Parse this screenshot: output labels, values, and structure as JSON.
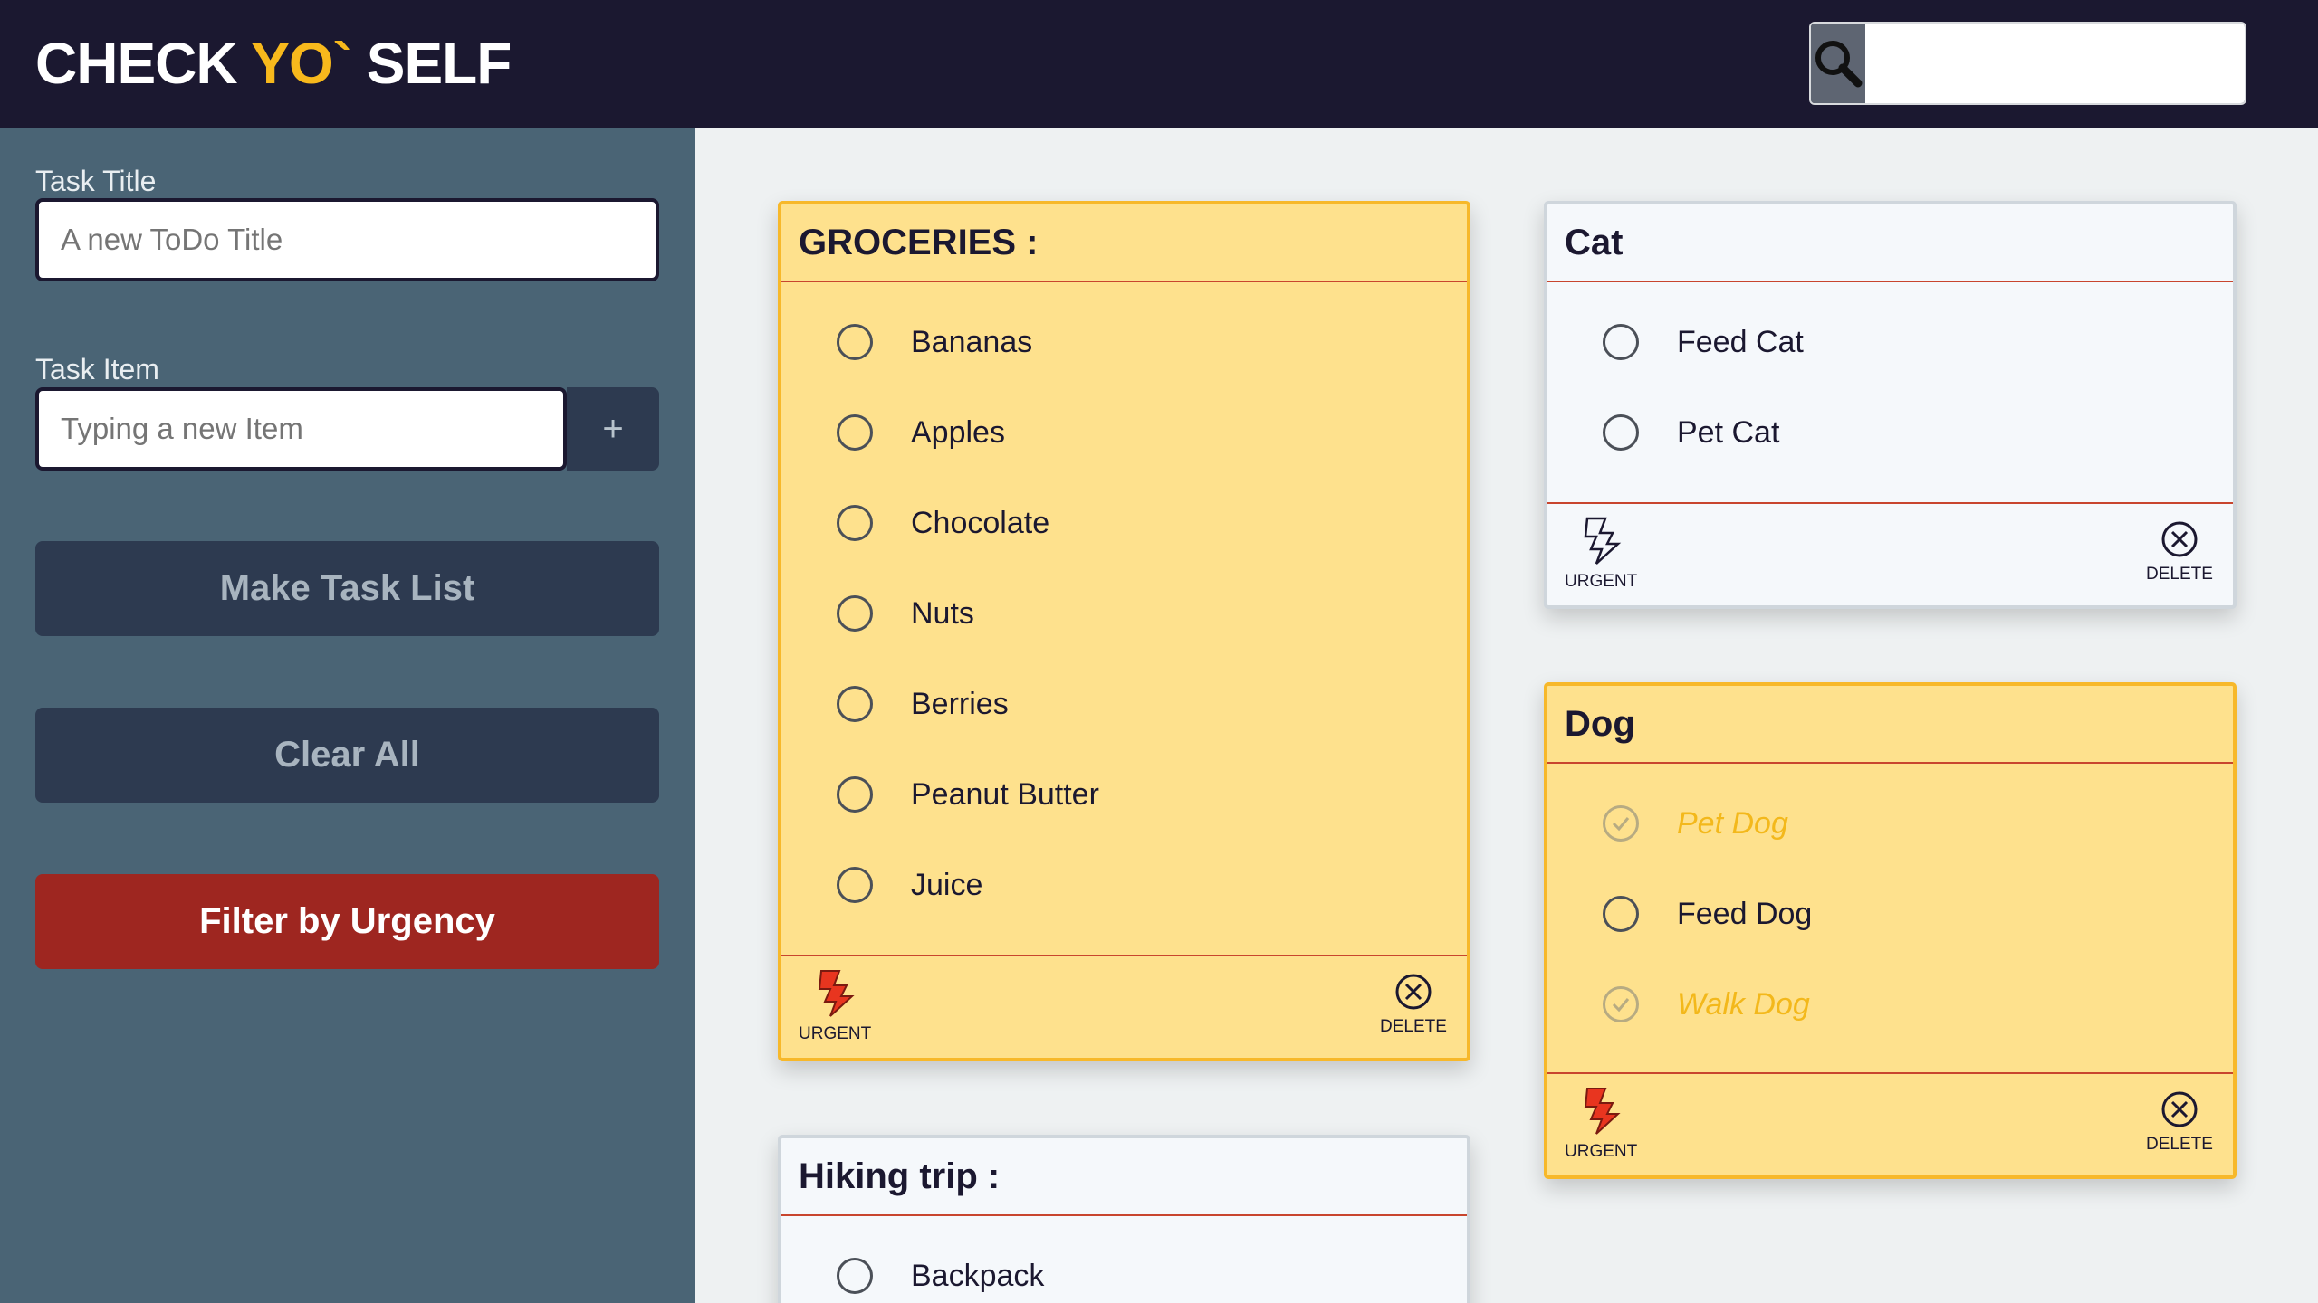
{
  "header": {
    "logo_part1": "CHECK ",
    "logo_accent": "YO`",
    "logo_part2": " SELF",
    "search_value": ""
  },
  "sidebar": {
    "task_title_label": "Task Title",
    "task_title_placeholder": "A new ToDo Title",
    "task_item_label": "Task Item",
    "task_item_placeholder": "Typing a new Item",
    "add_item_label": "+",
    "make_task_list_label": "Make Task List",
    "clear_all_label": "Clear All",
    "filter_urgency_label": "Filter by Urgency"
  },
  "colors": {
    "header_bg": "#1b1830",
    "sidebar_bg": "#4a6475",
    "accent": "#f8b91c",
    "urgent_card_bg": "#fee18d",
    "filter_button": "#9e2620"
  },
  "cards": {
    "groceries": {
      "title": "GROCERIES :",
      "urgent": true,
      "items": [
        {
          "text": "Bananas",
          "done": false
        },
        {
          "text": "Apples",
          "done": false
        },
        {
          "text": "Chocolate",
          "done": false
        },
        {
          "text": "Nuts",
          "done": false
        },
        {
          "text": "Berries",
          "done": false
        },
        {
          "text": "Peanut Butter",
          "done": false
        },
        {
          "text": "Juice",
          "done": false
        }
      ],
      "urgent_label": "URGENT",
      "delete_label": "DELETE"
    },
    "cat": {
      "title": "Cat",
      "urgent": false,
      "items": [
        {
          "text": "Feed Cat",
          "done": false
        },
        {
          "text": "Pet Cat",
          "done": false
        }
      ],
      "urgent_label": "URGENT",
      "delete_label": "DELETE"
    },
    "dog": {
      "title": "Dog",
      "urgent": true,
      "items": [
        {
          "text": "Pet Dog",
          "done": true
        },
        {
          "text": "Feed Dog",
          "done": false
        },
        {
          "text": "Walk Dog",
          "done": true
        }
      ],
      "urgent_label": "URGENT",
      "delete_label": "DELETE"
    },
    "hiking": {
      "title": "Hiking trip :",
      "urgent": false,
      "items": [
        {
          "text": "Backpack",
          "done": false
        }
      ]
    }
  }
}
